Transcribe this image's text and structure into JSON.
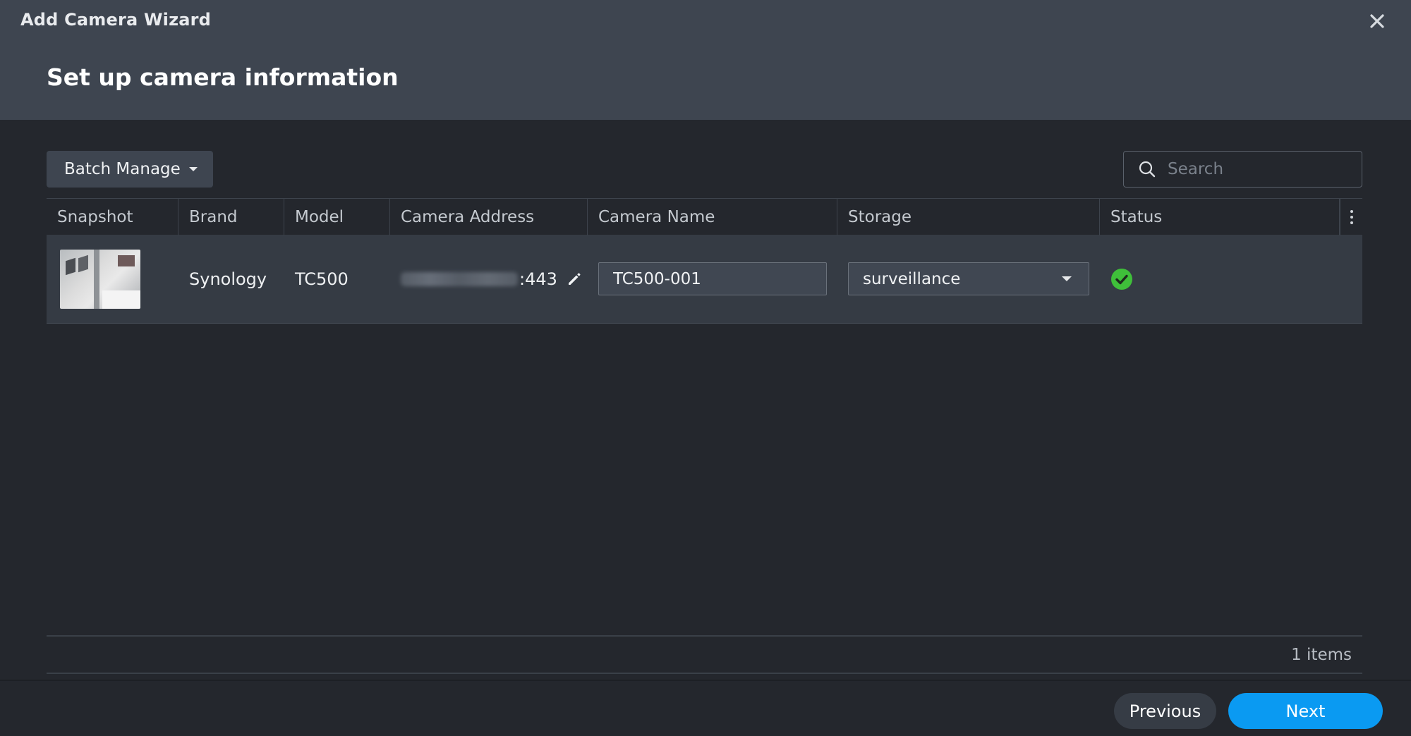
{
  "window": {
    "title": "Add Camera Wizard"
  },
  "page": {
    "title": "Set up camera information"
  },
  "toolbar": {
    "batch_manage_label": "Batch Manage"
  },
  "search": {
    "placeholder": "Search"
  },
  "table": {
    "columns": [
      "Snapshot",
      "Brand",
      "Model",
      "Camera Address",
      "Camera Name",
      "Storage",
      "Status"
    ],
    "rows": [
      {
        "brand": "Synology",
        "model": "TC500",
        "address_port": ":443",
        "camera_name": "TC500-001",
        "storage": "surveillance",
        "status": "ok"
      }
    ]
  },
  "footer": {
    "items_count": "1 items",
    "previous_label": "Previous",
    "next_label": "Next"
  },
  "colors": {
    "accent": "#0a9af2",
    "status_ok": "#3fbf3a"
  },
  "icons": [
    "close-icon",
    "chevron-down-icon",
    "search-icon",
    "more-vertical-icon",
    "pencil-icon",
    "check-circle-icon"
  ]
}
